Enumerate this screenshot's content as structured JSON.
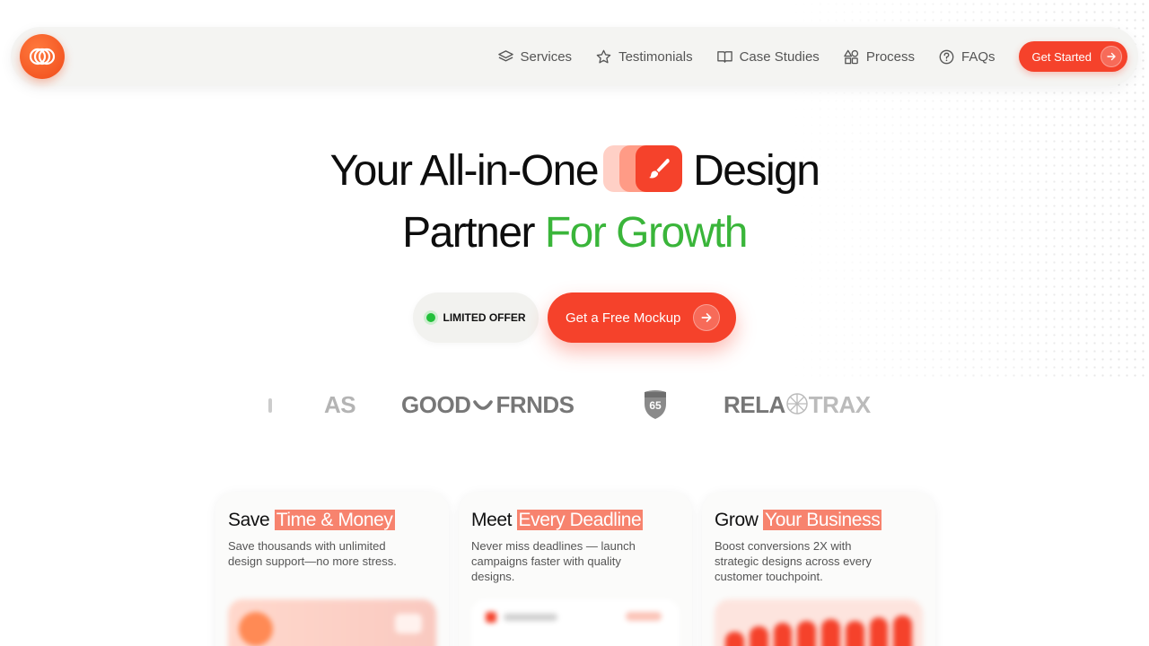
{
  "nav": {
    "items": [
      {
        "label": "Services",
        "icon": "layers-icon"
      },
      {
        "label": "Testimonials",
        "icon": "star-icon"
      },
      {
        "label": "Case Studies",
        "icon": "book-icon"
      },
      {
        "label": "Process",
        "icon": "shapes-icon"
      },
      {
        "label": "FAQs",
        "icon": "question-icon"
      }
    ],
    "cta_label": "Get Started"
  },
  "hero": {
    "line1_a": "Your All-in-One",
    "line1_b": "Design",
    "line2_a": "Partner",
    "line2_b": "For Growth"
  },
  "cta": {
    "offer_label": "LIMITED OFFER",
    "button_label": "Get a Free Mockup"
  },
  "logos": {
    "l1": "AS",
    "l2a": "GOOD",
    "l2b": "FRNDS",
    "l3": "65",
    "l4a": "RELA",
    "l4b": "TRAX"
  },
  "cards": [
    {
      "title_a": "Save",
      "title_b": "Time & Money",
      "desc": "Save thousands with unlimited design support—no more stress."
    },
    {
      "title_a": "Meet",
      "title_b": "Every Deadline",
      "desc": "Never miss deadlines — launch campaigns faster with quality designs."
    },
    {
      "title_a": "Grow",
      "title_b": "Your Business",
      "desc": "Boost conversions 2X with strategic designs  across every customer touchpoint."
    }
  ],
  "colors": {
    "accent": "#f5422b",
    "green": "#3ab53a",
    "highlight": "#f7836e"
  }
}
